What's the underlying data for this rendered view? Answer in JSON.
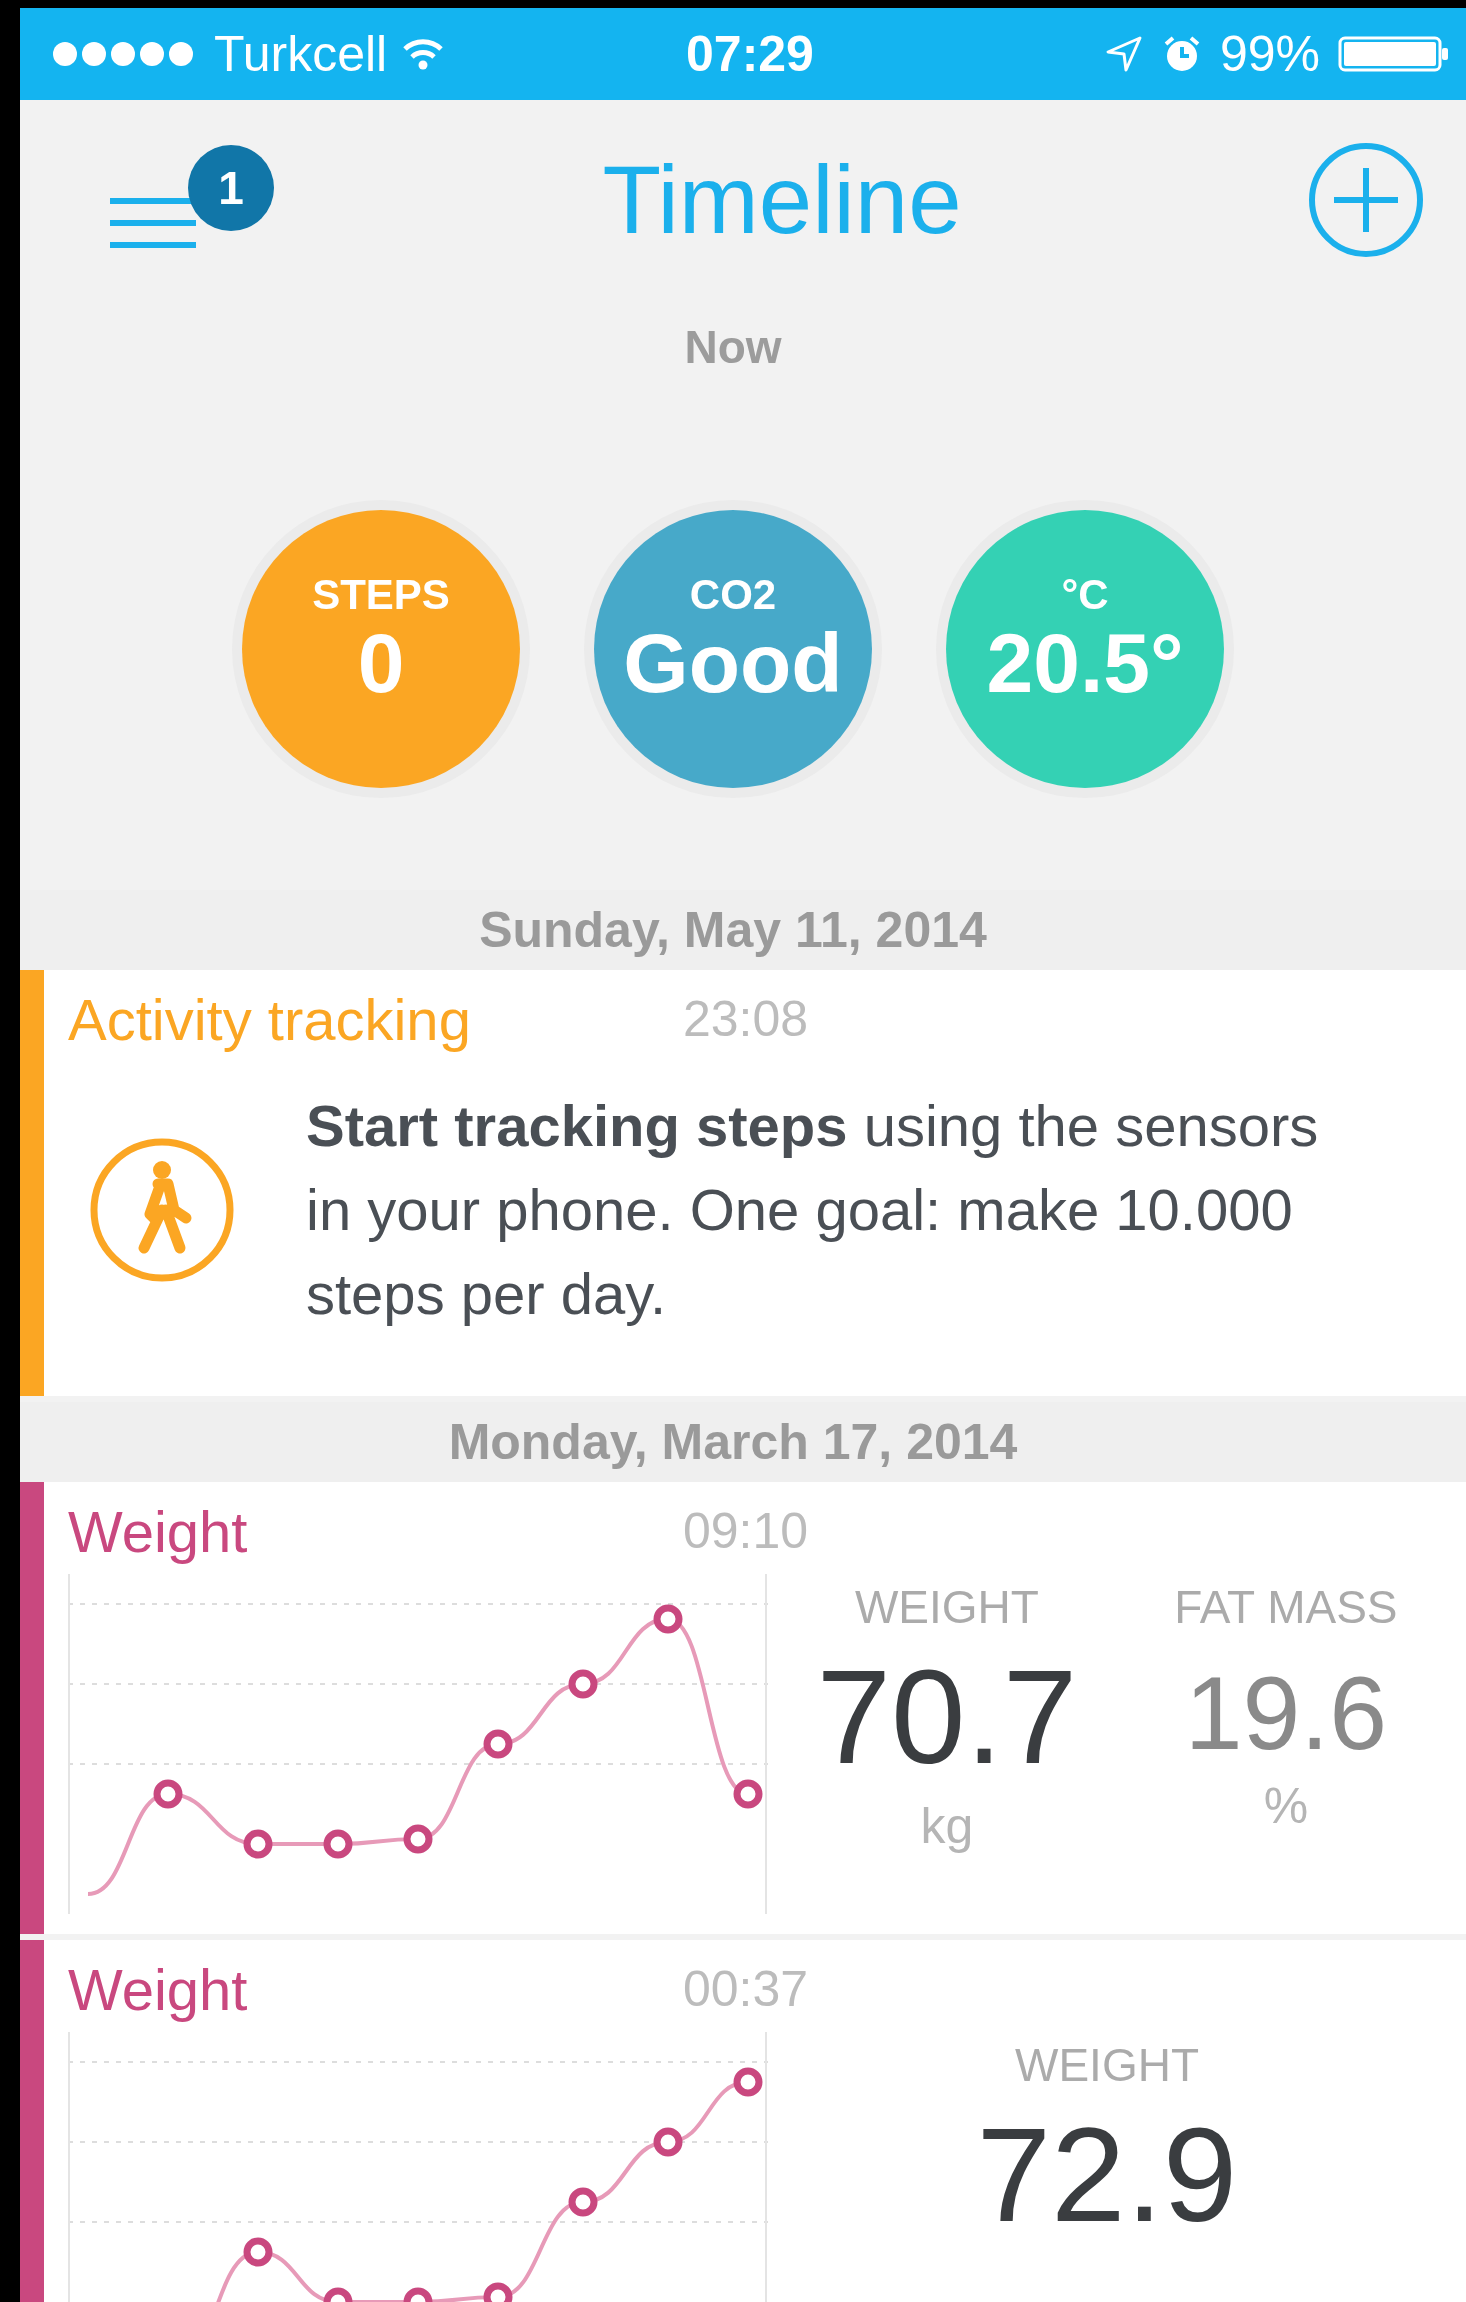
{
  "status_bar": {
    "carrier": "Turkcell",
    "time": "07:29",
    "battery": "99%"
  },
  "header": {
    "title": "Timeline",
    "badge": "1"
  },
  "now_label": "Now",
  "metrics": [
    {
      "label": "STEPS",
      "value": "0",
      "color": "#fba623"
    },
    {
      "label": "CO2",
      "value": "Good",
      "color": "#47a9c9"
    },
    {
      "label": "°C",
      "value": "20.5°",
      "color": "#34d1b4"
    }
  ],
  "sections": [
    {
      "date": "Sunday, May 11, 2014",
      "cards": [
        {
          "kind": "activity",
          "title": "Activity tracking",
          "time": "23:08",
          "color": "#fba623",
          "text": "**Start tracking steps** using the sensors in your phone. One goal: make 10.000 steps per day."
        }
      ]
    },
    {
      "date": "Monday, March 17, 2014",
      "cards": [
        {
          "kind": "weight",
          "title": "Weight",
          "time": "09:10",
          "color": "#c9487f",
          "stats": [
            {
              "label": "WEIGHT",
              "value": "70.7",
              "unit": "kg",
              "primary": true
            },
            {
              "label": "FAT MASS",
              "value": "19.6",
              "unit": "%",
              "primary": false
            }
          ]
        },
        {
          "kind": "weight",
          "title": "Weight",
          "time": "00:37",
          "color": "#c9487f",
          "stats": [
            {
              "label": "WEIGHT",
              "value": "72.9",
              "primary": true
            }
          ]
        }
      ]
    }
  ]
}
